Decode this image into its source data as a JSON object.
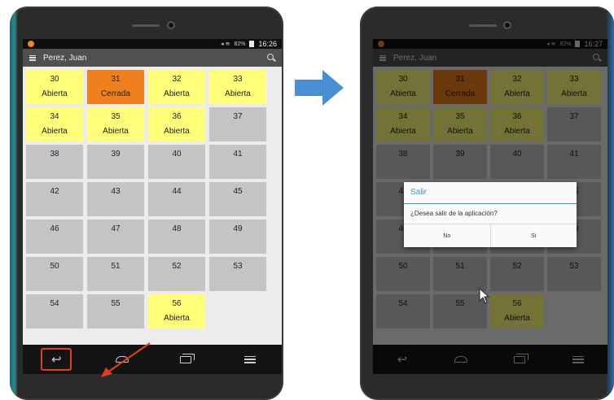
{
  "left_screen": {
    "status_time": "16:26",
    "battery": "82%",
    "user_name": "Perez, Juan",
    "cells": [
      {
        "num": "30",
        "status": "Abierta",
        "state": "open"
      },
      {
        "num": "31",
        "status": "Cerrada",
        "state": "closed"
      },
      {
        "num": "32",
        "status": "Abierta",
        "state": "open"
      },
      {
        "num": "33",
        "status": "Abierta",
        "state": "open"
      },
      {
        "num": "34",
        "status": "Abierta",
        "state": "open"
      },
      {
        "num": "35",
        "status": "Abierta",
        "state": "open"
      },
      {
        "num": "36",
        "status": "Abierta",
        "state": "open"
      },
      {
        "num": "37",
        "status": "",
        "state": "empty"
      },
      {
        "num": "38",
        "status": "",
        "state": "empty"
      },
      {
        "num": "39",
        "status": "",
        "state": "empty"
      },
      {
        "num": "40",
        "status": "",
        "state": "empty"
      },
      {
        "num": "41",
        "status": "",
        "state": "empty"
      },
      {
        "num": "42",
        "status": "",
        "state": "empty"
      },
      {
        "num": "43",
        "status": "",
        "state": "empty"
      },
      {
        "num": "44",
        "status": "",
        "state": "empty"
      },
      {
        "num": "45",
        "status": "",
        "state": "empty"
      },
      {
        "num": "46",
        "status": "",
        "state": "empty"
      },
      {
        "num": "47",
        "status": "",
        "state": "empty"
      },
      {
        "num": "48",
        "status": "",
        "state": "empty"
      },
      {
        "num": "49",
        "status": "",
        "state": "empty"
      },
      {
        "num": "50",
        "status": "",
        "state": "empty"
      },
      {
        "num": "51",
        "status": "",
        "state": "empty"
      },
      {
        "num": "52",
        "status": "",
        "state": "empty"
      },
      {
        "num": "53",
        "status": "",
        "state": "empty"
      },
      {
        "num": "54",
        "status": "",
        "state": "empty"
      },
      {
        "num": "55",
        "status": "",
        "state": "empty"
      },
      {
        "num": "56",
        "status": "Abierta",
        "state": "open"
      }
    ]
  },
  "right_screen": {
    "status_time": "16:27",
    "battery": "82%",
    "user_name": "Perez, Juan",
    "dialog": {
      "title": "Salir",
      "message": "¿Desea salir de la aplicación?",
      "no_label": "No",
      "yes_label": "Si"
    }
  },
  "colors": {
    "open": "#ffff7a",
    "closed": "#f07f1d",
    "empty": "#c4c4c4",
    "accent": "#3b98c9",
    "highlight": "#e0401f",
    "transition_arrow": "#4a8fd4"
  },
  "icons": {
    "status_app": "notification-icon",
    "menu": "menu-icon",
    "search": "search-icon",
    "nav_back": "back-icon",
    "nav_home": "home-icon",
    "nav_recent": "recent-apps-icon",
    "nav_menu": "menu-lines-icon"
  }
}
